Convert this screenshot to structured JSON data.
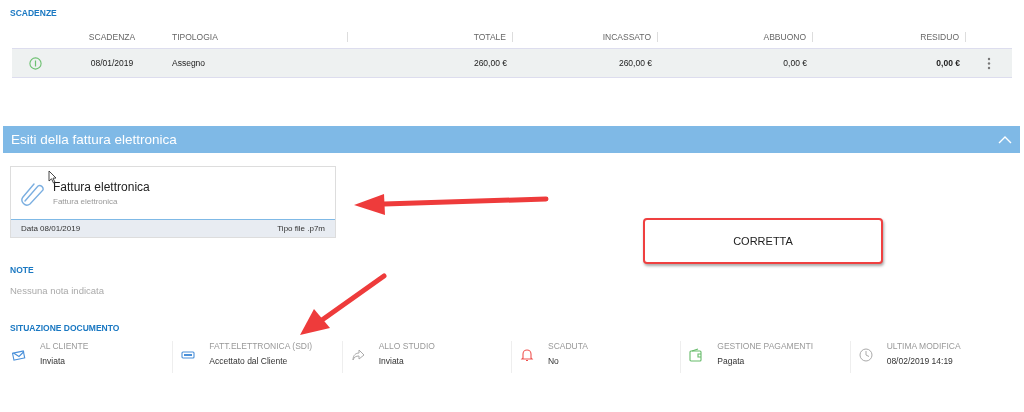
{
  "scadenze": {
    "title": "SCADENZE",
    "columns": [
      "SCADENZA",
      "TIPOLOGIA",
      "TOTALE",
      "INCASSATO",
      "ABBUONO",
      "RESIDUO"
    ],
    "rows": [
      {
        "cells": [
          "08/01/2019",
          "Assegno",
          "260,00 €",
          "260,00 €",
          "0,00 €",
          "0,00 €"
        ]
      }
    ]
  },
  "esiti": {
    "title": "Esiti della fattura elettronica",
    "expanded": true,
    "file": {
      "title": "Fattura elettronica",
      "subtitle": "Fattura elettronica",
      "date": "Data 08/01/2019",
      "type": "Tipo file .p7m"
    },
    "callout": "CORRETTA"
  },
  "note": {
    "title": "NOTE",
    "text": "Nessuna nota indicata"
  },
  "situazione": {
    "title": "SITUAZIONE DOCUMENTO",
    "items": [
      {
        "label": "AL CLIENTE",
        "value": "Inviata"
      },
      {
        "label": "FATT.ELETTRONICA (SDI)",
        "value": "Accettato dal Cliente"
      },
      {
        "label": "ALLO STUDIO",
        "value": "Inviata"
      },
      {
        "label": "SCADUTA",
        "value": "No"
      },
      {
        "label": "GESTIONE PAGAMENTI",
        "value": "Pagata"
      },
      {
        "label": "ULTIMA MODIFICA",
        "value": "08/02/2019 14:19"
      }
    ]
  }
}
